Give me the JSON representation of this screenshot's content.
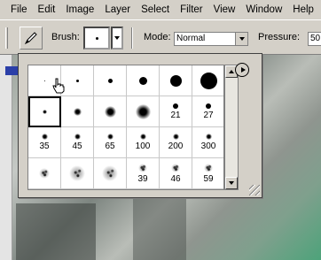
{
  "menubar": {
    "items": [
      "File",
      "Edit",
      "Image",
      "Layer",
      "Select",
      "Filter",
      "View",
      "Window",
      "Help"
    ]
  },
  "options_bar": {
    "tool_icon": "brush-tool-icon",
    "brush_label": "Brush:",
    "mode_label": "Mode:",
    "mode_value": "Normal",
    "pressure_label": "Pressure:",
    "pressure_value": "50"
  },
  "brush_picker": {
    "rows": [
      [
        {
          "type": "hard",
          "size": 1,
          "label": ""
        },
        {
          "type": "hard",
          "size": 3,
          "label": ""
        },
        {
          "type": "hard",
          "size": 5,
          "label": ""
        },
        {
          "type": "hard",
          "size": 9,
          "label": ""
        },
        {
          "type": "hard",
          "size": 13,
          "label": ""
        },
        {
          "type": "hard",
          "size": 19,
          "label": ""
        }
      ],
      [
        {
          "type": "soft",
          "size": 5,
          "label": "",
          "selected": true
        },
        {
          "type": "soft",
          "size": 9,
          "label": ""
        },
        {
          "type": "soft",
          "size": 13,
          "label": ""
        },
        {
          "type": "soft",
          "size": 17,
          "label": ""
        },
        {
          "type": "hard",
          "size": 6,
          "label": "21"
        },
        {
          "type": "hard",
          "size": 6,
          "label": "27"
        }
      ],
      [
        {
          "type": "soft",
          "size": 7,
          "label": "35"
        },
        {
          "type": "soft",
          "size": 7,
          "label": "45"
        },
        {
          "type": "soft",
          "size": 7,
          "label": "65"
        },
        {
          "type": "soft",
          "size": 7,
          "label": "100"
        },
        {
          "type": "soft",
          "size": 7,
          "label": "200"
        },
        {
          "type": "soft",
          "size": 7,
          "label": "300"
        }
      ],
      [
        {
          "type": "splatter",
          "size": 12,
          "label": ""
        },
        {
          "type": "splatter",
          "size": 18,
          "label": ""
        },
        {
          "type": "splatter",
          "size": 18,
          "label": ""
        },
        {
          "type": "splatter",
          "size": 10,
          "label": "39"
        },
        {
          "type": "splatter",
          "size": 10,
          "label": "46"
        },
        {
          "type": "splatter",
          "size": 10,
          "label": "59"
        }
      ]
    ],
    "menu_icon": "flyout-arrow-icon",
    "cursor_icon": "hand-pointer-icon"
  }
}
